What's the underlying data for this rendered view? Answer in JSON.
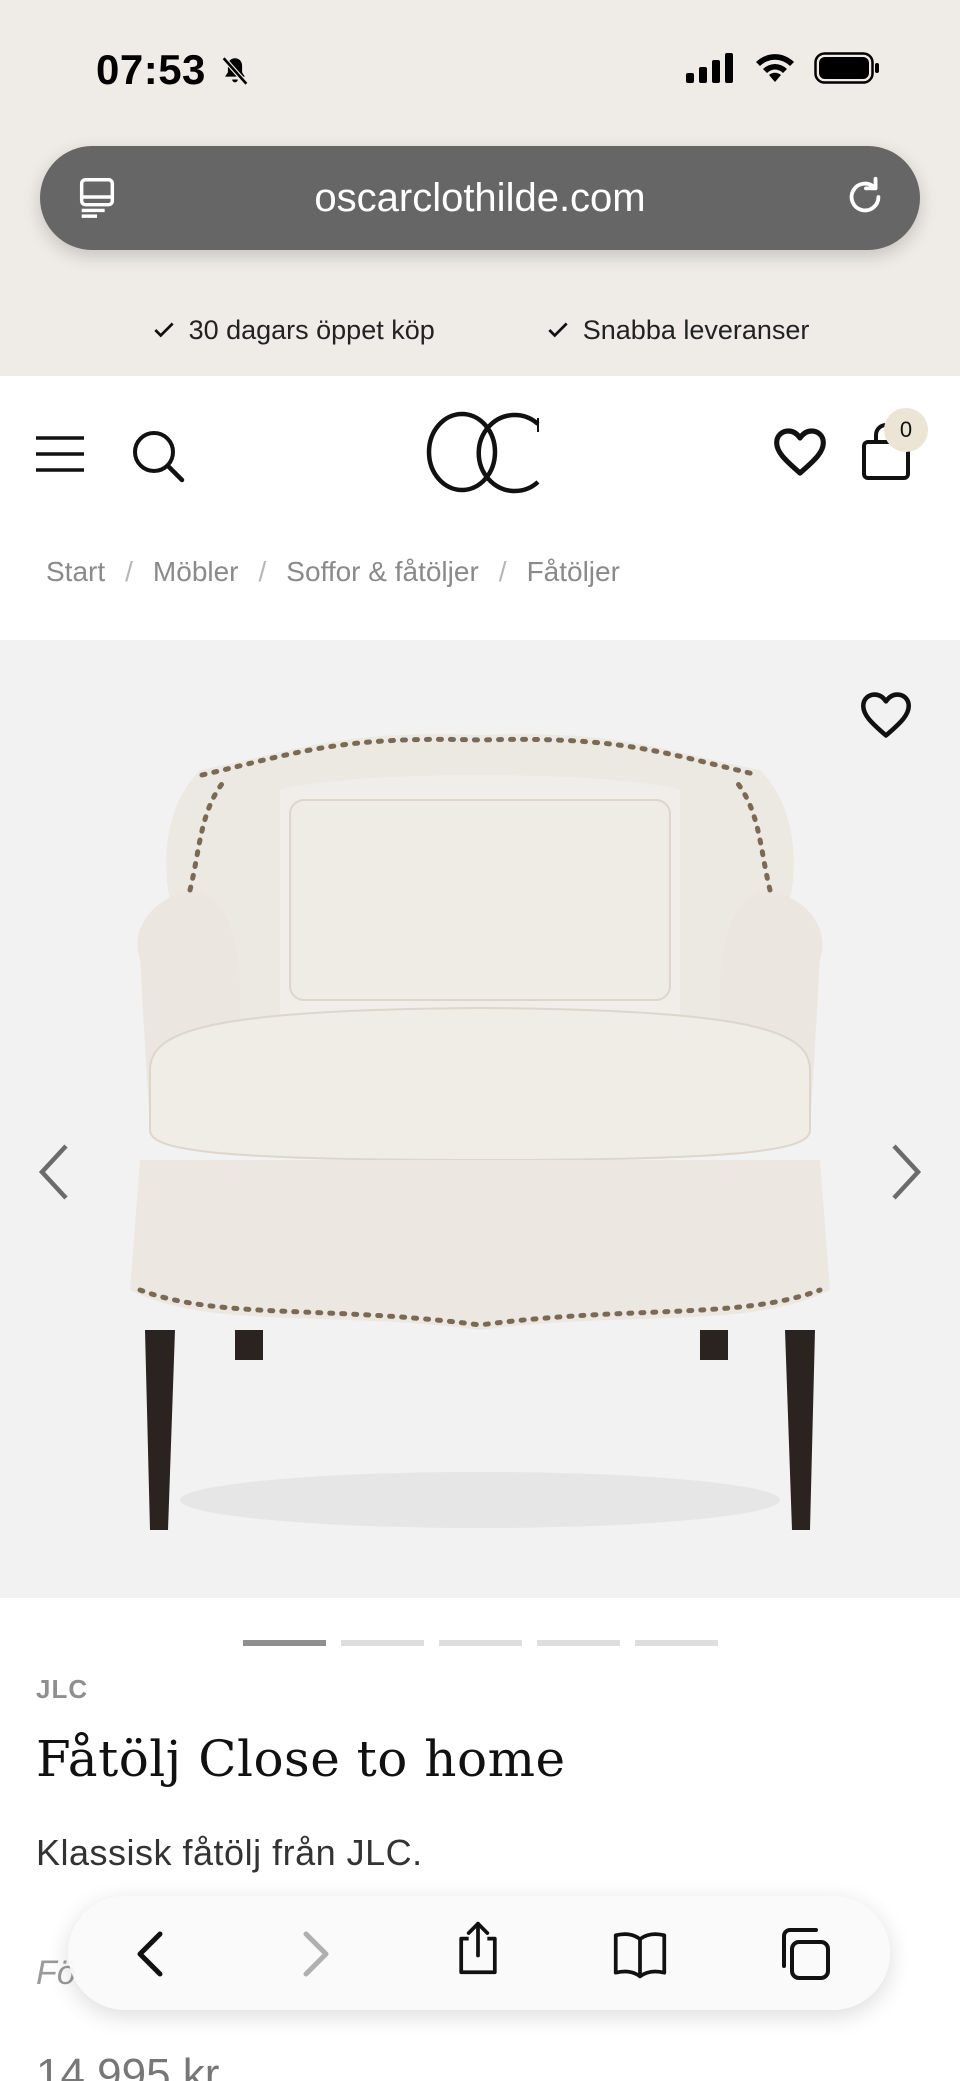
{
  "status_bar": {
    "time": "07:53"
  },
  "browser": {
    "url": "oscarclothilde.com"
  },
  "usps": [
    "30 dagars öppet köp",
    "Snabba leveranser"
  ],
  "header": {
    "cart_count": "0"
  },
  "breadcrumb": [
    "Start",
    "Möbler",
    "Soffor & fåtöljer",
    "Fåtöljer"
  ],
  "breadcrumb_separator": "/",
  "gallery": {
    "slide_count": 5,
    "active_slide": 1
  },
  "product": {
    "brand": "JLC",
    "title": "Fåtölj Close to home",
    "subtitle": "Klassisk fåtölj från JLC.",
    "obscured_text": "Fö",
    "price": "14 995 kr"
  },
  "icons": [
    "bell-slash-icon",
    "signal-icon",
    "wifi-icon",
    "battery-icon",
    "tabs-icon",
    "reload-icon",
    "check-icon",
    "menu-icon",
    "search-icon",
    "heart-icon",
    "bag-icon",
    "chevron-left-icon",
    "chevron-right-icon",
    "back-icon",
    "forward-icon",
    "share-icon",
    "bookmarks-icon",
    "tabs-overview-icon"
  ],
  "colors": {
    "chrome_bg": "#efece7",
    "url_bar": "#666666",
    "badge": "#ece5d6",
    "gallery_bg": "#f2f2f2"
  }
}
